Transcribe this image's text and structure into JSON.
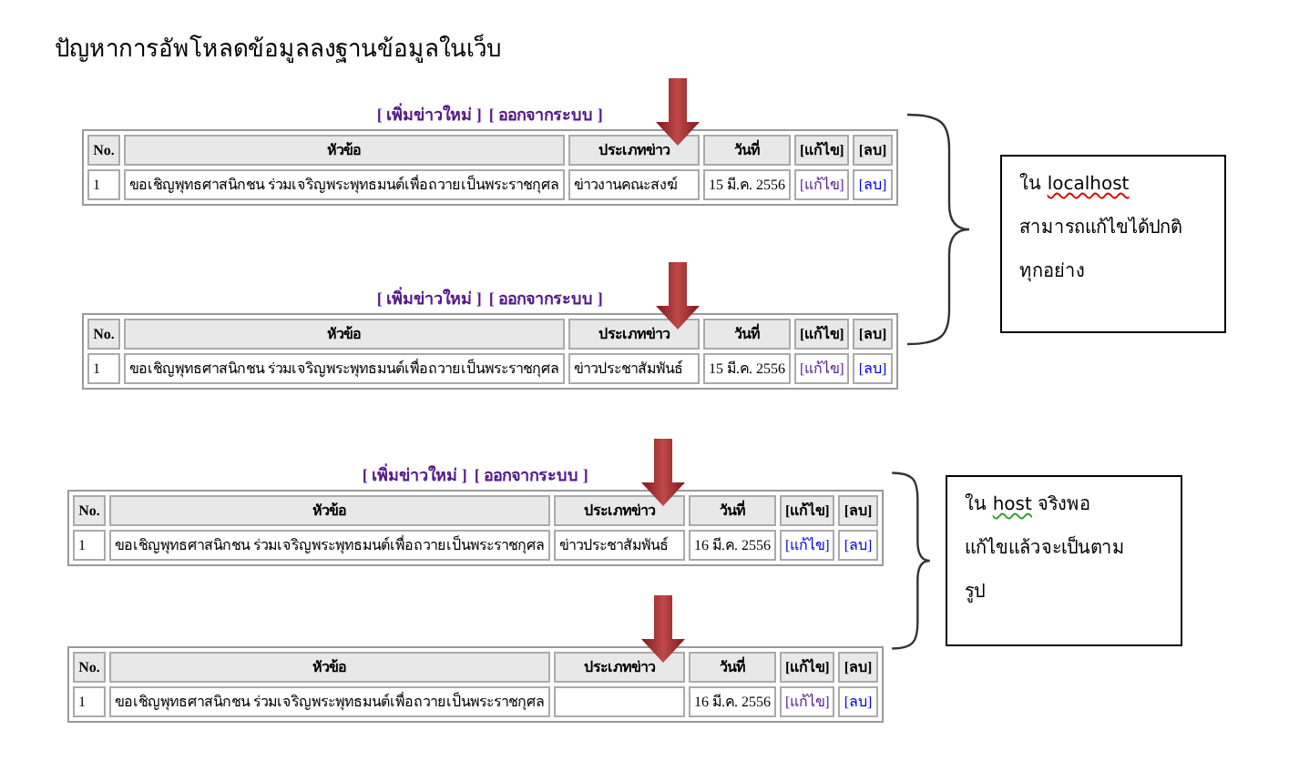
{
  "title": "ปัญหาการอัพโหลดข้อมูลลงฐานข้อมูลในเว็บ",
  "sections": [
    {
      "panels": [
        {
          "links": [
            {
              "text": "[ เพิ่มข่าวใหม่ ]"
            },
            {
              "text": "[ ออกจากระบบ ]"
            }
          ],
          "columns": [
            "No.",
            "หัวข้อ",
            "ประเภทข่าว",
            "วันที่",
            "[แก้ไข]",
            "[ลบ]"
          ],
          "rows": [
            {
              "no": "1",
              "subject": "ขอเชิญพุทธศาสนิกชน ร่วมเจริญพระพุทธมนต์เพื่อถวายเป็นพระราชกุศล",
              "type": "ข่าวงานคณะสงฆ์",
              "date": "15 มี.ค. 2556",
              "edit": {
                "text": "[แก้ไข]",
                "visited": true
              },
              "delete": {
                "text": "[ลบ]",
                "visited": false
              }
            }
          ]
        },
        {
          "links": [
            {
              "text": "[ เพิ่มข่าวใหม่ ]"
            },
            {
              "text": "[ ออกจากระบบ ]"
            }
          ],
          "columns": [
            "No.",
            "หัวข้อ",
            "ประเภทข่าว",
            "วันที่",
            "[แก้ไข]",
            "[ลบ]"
          ],
          "rows": [
            {
              "no": "1",
              "subject": "ขอเชิญพุทธศาสนิกชน ร่วมเจริญพระพุทธมนต์เพื่อถวายเป็นพระราชกุศล",
              "type": "ข่าวประชาสัมพันธ์",
              "date": "15 มี.ค. 2556",
              "edit": {
                "text": "[แก้ไข]",
                "visited": true
              },
              "delete": {
                "text": "[ลบ]",
                "visited": false
              }
            }
          ]
        }
      ],
      "note": [
        {
          "parts": [
            {
              "text": "ใน "
            },
            {
              "text": "localhost",
              "color": "#e00000"
            }
          ]
        },
        {
          "parts": [
            {
              "text": "สามารถแก้ไขได้ปกติ"
            }
          ]
        },
        {
          "parts": [
            {
              "text": "ทุกอย่าง"
            }
          ]
        }
      ]
    },
    {
      "panels": [
        {
          "links": [
            {
              "text": "[ เพิ่มข่าวใหม่ ]"
            },
            {
              "text": "[ ออกจากระบบ ]"
            }
          ],
          "columns": [
            "No.",
            "หัวข้อ",
            "ประเภทข่าว",
            "วันที่",
            "[แก้ไข]",
            "[ลบ]"
          ],
          "rows": [
            {
              "no": "1",
              "subject": "ขอเชิญพุทธศาสนิกชน ร่วมเจริญพระพุทธมนต์เพื่อถวายเป็นพระราชกุศล",
              "type": "ข่าวประชาสัมพันธ์",
              "date": "16 มี.ค. 2556",
              "edit": {
                "text": "[แก้ไข]",
                "visited": false
              },
              "delete": {
                "text": "[ลบ]",
                "visited": false
              }
            }
          ]
        },
        {
          "columns": [
            "No.",
            "หัวข้อ",
            "ประเภทข่าว",
            "วันที่",
            "[แก้ไข]",
            "[ลบ]"
          ],
          "rows": [
            {
              "no": "1",
              "subject": "ขอเชิญพุทธศาสนิกชน ร่วมเจริญพระพุทธมนต์เพื่อถวายเป็นพระราชกุศล",
              "date": "16 มี.ค. 2556",
              "edit": {
                "text": "[แก้ไข]",
                "visited": true
              },
              "delete": {
                "text": "[ลบ]",
                "visited": false
              }
            }
          ]
        }
      ],
      "note": [
        {
          "parts": [
            {
              "text": "ใน "
            },
            {
              "text": "host",
              "color": "#2a9d2a"
            },
            {
              "text": " จริงพอ"
            }
          ]
        },
        {
          "parts": [
            {
              "text": "แก้ไขแล้วจะเป็นตาม"
            }
          ]
        },
        {
          "parts": [
            {
              "text": "รูป"
            }
          ]
        }
      ]
    }
  ]
}
